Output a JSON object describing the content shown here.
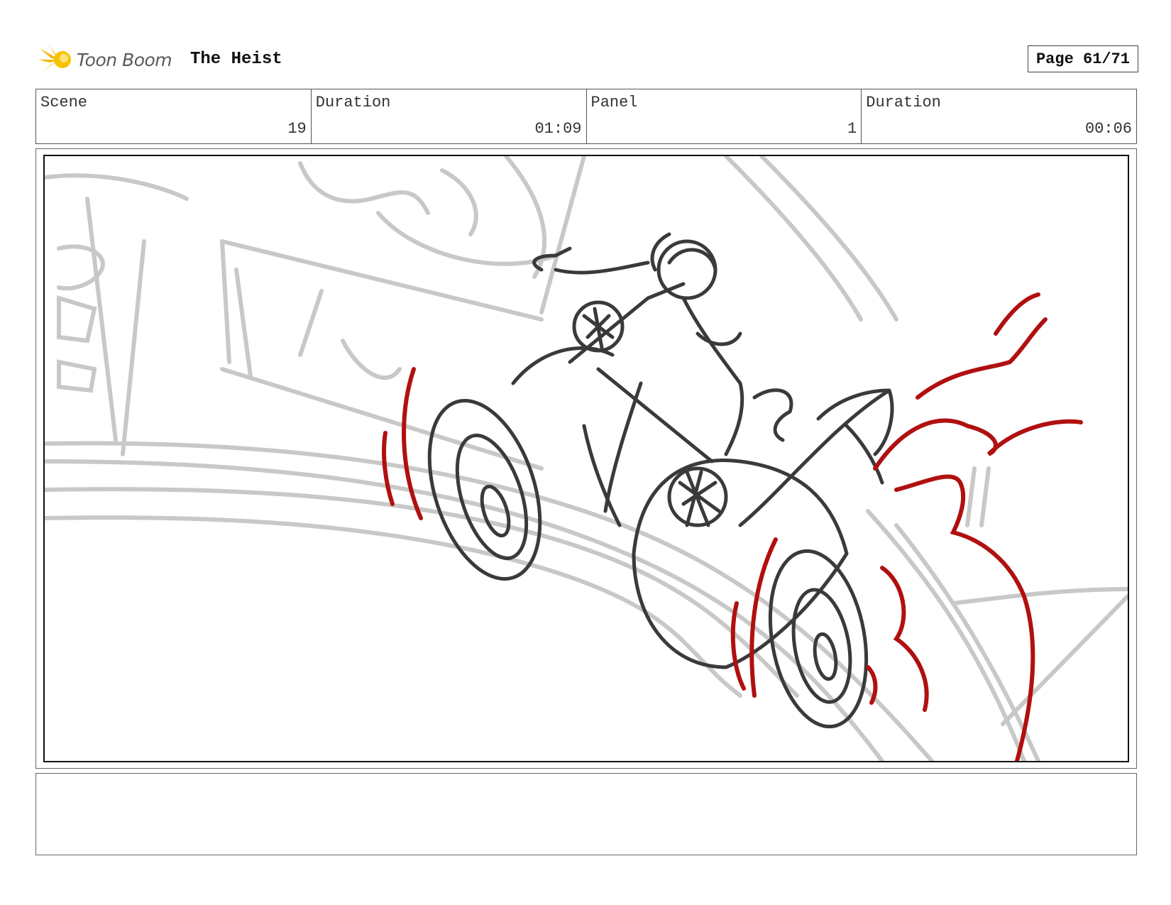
{
  "header": {
    "logo_text": "Toon Boom",
    "project_title": "The Heist",
    "page_label": "Page 61/71"
  },
  "info": [
    {
      "label": "Scene",
      "value": "19"
    },
    {
      "label": "Duration",
      "value": "01:09"
    },
    {
      "label": "Panel",
      "value": "1"
    },
    {
      "label": "Duration",
      "value": "00:06"
    }
  ],
  "panel": {
    "description": "",
    "colors": {
      "sketch_dark": "#333333",
      "sketch_light": "#c8c8c8",
      "accent_red": "#b01010",
      "logo_yellow": "#f5b800"
    }
  },
  "notes": {
    "text": ""
  }
}
